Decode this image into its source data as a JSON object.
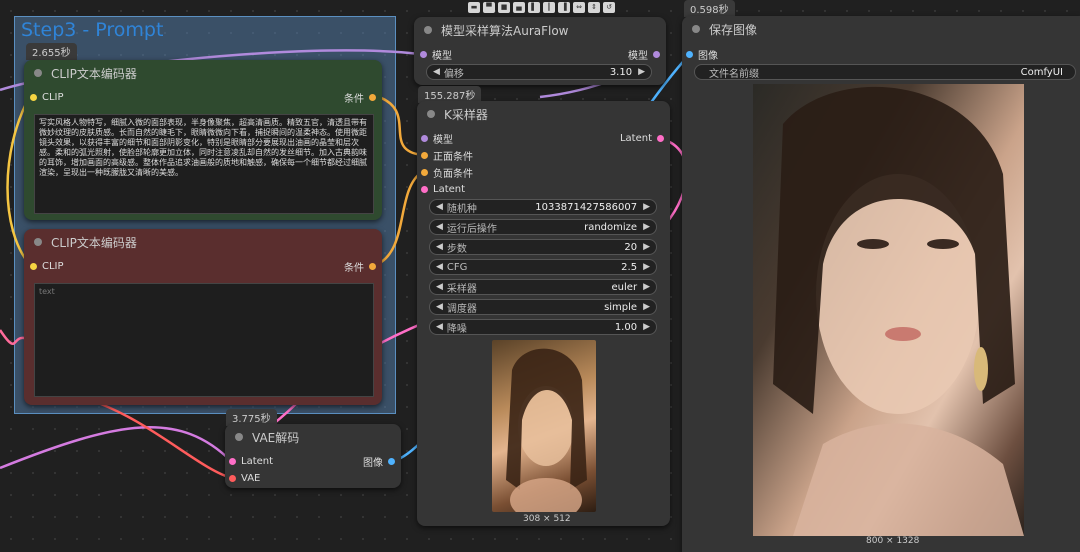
{
  "group": {
    "title": "Step3 - Prompt"
  },
  "times": {
    "clip_pos": "2.655秒",
    "ksampler": "155.287秒",
    "vae": "3.775秒",
    "save": "0.598秒"
  },
  "clip_positive": {
    "title": "CLIP文本编码器",
    "in_clip": "CLIP",
    "out_cond": "条件",
    "text": "写实风格人物特写，细腻入微的面部表现，半身像聚焦，超高清画质。精致五官，清透且带有微妙纹理的皮肤质感。长而自然的睫毛下，眼睛微微向下看，捕捉瞬间的温柔神态。使用微距镜头效果，以获得丰富的细节和面部阴影变化，特别是眼睛部分要展现出油画的晶莹和层次感。柔和的弧光照射，使脸部轮廓更加立体，同时注意凌乱却自然的发丝细节。加入古典韵味的耳饰，增加画面的高级感。整体作品追求油画般的质地和触感，确保每一个细节都经过细腻渲染，呈现出一种既朦胧又清晰的美感。",
    "color": "#2f4a2f"
  },
  "clip_negative": {
    "title": "CLIP文本编码器",
    "in_clip": "CLIP",
    "out_cond": "条件",
    "placeholder": "text",
    "color": "#5a2e2e"
  },
  "aura": {
    "title": "模型采样算法AuraFlow",
    "in_model": "模型",
    "out_model": "模型",
    "shift_label": "偏移",
    "shift_value": "3.10"
  },
  "ksampler": {
    "title": "K采样器",
    "inputs": [
      "模型",
      "正面条件",
      "负面条件",
      "Latent"
    ],
    "output": "Latent",
    "widgets": [
      {
        "label": "随机种",
        "value": "1033871427586007"
      },
      {
        "label": "运行后操作",
        "value": "randomize"
      },
      {
        "label": "步数",
        "value": "20"
      },
      {
        "label": "CFG",
        "value": "2.5"
      },
      {
        "label": "采样器",
        "value": "euler"
      },
      {
        "label": "调度器",
        "value": "simple"
      },
      {
        "label": "降噪",
        "value": "1.00"
      }
    ],
    "preview_size": "308 × 512"
  },
  "vae": {
    "title": "VAE解码",
    "in_latent": "Latent",
    "in_vae": "VAE",
    "out_image": "图像"
  },
  "save": {
    "title": "保存图像",
    "in_image": "图像",
    "prefix_label": "文件名前缀",
    "prefix_value": "ComfyUI",
    "size": "800 × 1328"
  },
  "toolbar_icons": [
    "move",
    "align-top",
    "align-middle",
    "align-bottom",
    "align-left",
    "align-center",
    "align-right",
    "distribute-h",
    "distribute-v",
    "reset"
  ]
}
